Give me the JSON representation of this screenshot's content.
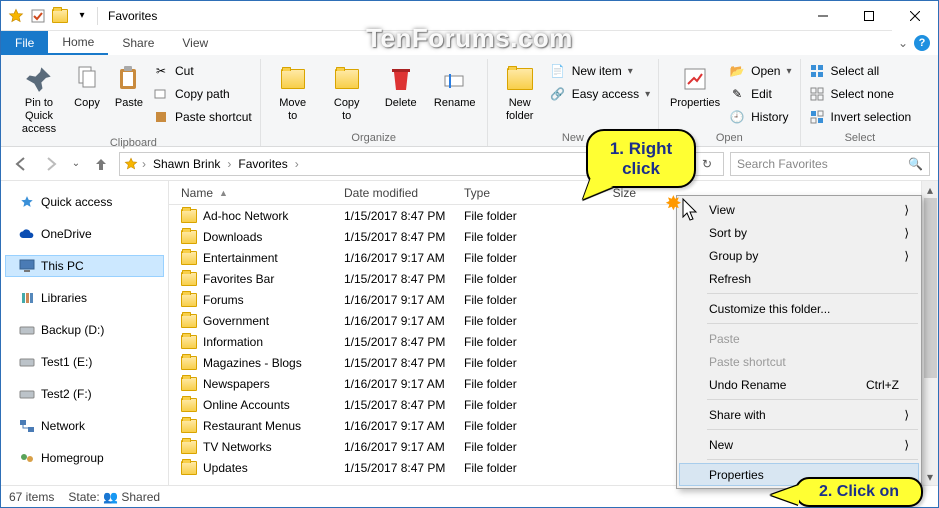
{
  "window": {
    "title": "Favorites"
  },
  "tabs": {
    "file": "File",
    "home": "Home",
    "share": "Share",
    "view": "View"
  },
  "ribbon": {
    "clipboard": {
      "label": "Clipboard",
      "pin": "Pin to Quick\naccess",
      "copy": "Copy",
      "paste": "Paste",
      "cut": "Cut",
      "copypath": "Copy path",
      "pasteshortcut": "Paste shortcut"
    },
    "organize": {
      "label": "Organize",
      "moveto": "Move\nto",
      "copyto": "Copy\nto",
      "delete": "Delete",
      "rename": "Rename"
    },
    "new": {
      "label": "New",
      "newfolder": "New\nfolder",
      "newitem": "New item",
      "easyaccess": "Easy access"
    },
    "open": {
      "label": "Open",
      "properties": "Properties",
      "open": "Open",
      "edit": "Edit",
      "history": "History"
    },
    "select": {
      "label": "Select",
      "selectall": "Select all",
      "selectnone": "Select none",
      "invert": "Invert selection"
    }
  },
  "breadcrumb": {
    "root_icon": "star",
    "items": [
      "Shawn Brink",
      "Favorites"
    ]
  },
  "search": {
    "placeholder": "Search Favorites"
  },
  "tree": {
    "quick_access": "Quick access",
    "onedrive": "OneDrive",
    "thispc": "This PC",
    "libraries": "Libraries",
    "backup": "Backup (D:)",
    "test1": "Test1 (E:)",
    "test2": "Test2 (F:)",
    "network": "Network",
    "homegroup": "Homegroup"
  },
  "columns": {
    "name": "Name",
    "date": "Date modified",
    "type": "Type",
    "size": "Size"
  },
  "files": [
    {
      "name": "Ad-hoc Network",
      "date": "1/15/2017 8:47 PM",
      "type": "File folder"
    },
    {
      "name": "Downloads",
      "date": "1/15/2017 8:47 PM",
      "type": "File folder"
    },
    {
      "name": "Entertainment",
      "date": "1/16/2017 9:17 AM",
      "type": "File folder"
    },
    {
      "name": "Favorites Bar",
      "date": "1/15/2017 8:47 PM",
      "type": "File folder"
    },
    {
      "name": "Forums",
      "date": "1/16/2017 9:17 AM",
      "type": "File folder"
    },
    {
      "name": "Government",
      "date": "1/16/2017 9:17 AM",
      "type": "File folder"
    },
    {
      "name": "Information",
      "date": "1/15/2017 8:47 PM",
      "type": "File folder"
    },
    {
      "name": "Magazines - Blogs",
      "date": "1/15/2017 8:47 PM",
      "type": "File folder"
    },
    {
      "name": "Newspapers",
      "date": "1/16/2017 9:17 AM",
      "type": "File folder"
    },
    {
      "name": "Online Accounts",
      "date": "1/15/2017 8:47 PM",
      "type": "File folder"
    },
    {
      "name": "Restaurant Menus",
      "date": "1/16/2017 9:17 AM",
      "type": "File folder"
    },
    {
      "name": "TV Networks",
      "date": "1/16/2017 9:17 AM",
      "type": "File folder"
    },
    {
      "name": "Updates",
      "date": "1/15/2017 8:47 PM",
      "type": "File folder"
    }
  ],
  "context_menu": {
    "view": "View",
    "sortby": "Sort by",
    "groupby": "Group by",
    "refresh": "Refresh",
    "customize": "Customize this folder...",
    "paste": "Paste",
    "pasteshortcut": "Paste shortcut",
    "undorename": "Undo Rename",
    "undorename_key": "Ctrl+Z",
    "sharewith": "Share with",
    "new": "New",
    "properties": "Properties"
  },
  "status": {
    "count": "67 items",
    "state_label": "State:",
    "state_value": "Shared"
  },
  "callouts": {
    "one": "1. Right click",
    "two": "2. Click on"
  },
  "watermark": "TenForums.com"
}
